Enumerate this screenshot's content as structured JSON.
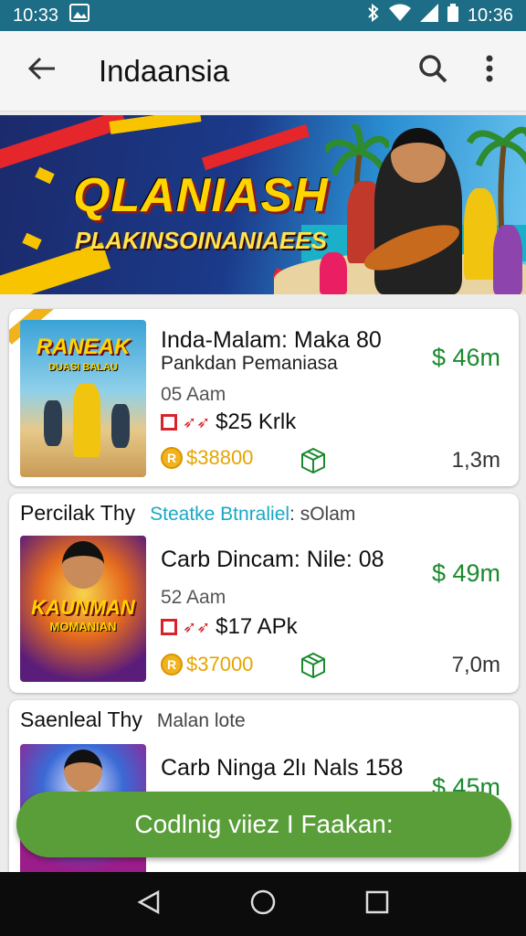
{
  "status_bar": {
    "time_left": "10:33",
    "time_right": "10:36",
    "background": "#1e6d86",
    "icons": [
      "image-icon",
      "bluetooth-icon",
      "wifi-icon",
      "signal-icon",
      "battery-icon"
    ]
  },
  "app_bar": {
    "title": "Indaansia",
    "icons": [
      "back-arrow-icon",
      "search-icon",
      "more-vert-icon"
    ]
  },
  "banner": {
    "title": "QLANIASH",
    "subtitle": "PLAKINSOINANIAEES"
  },
  "cards": [
    {
      "header_title": "",
      "header_sub": "",
      "thumb_title": "RANEAK",
      "thumb_title2": "DUASI BALAU",
      "title": "Inda-Malam: Maka 80",
      "subtitle": "Pankdan Pemaniasa",
      "time": "05 Aam",
      "price": "$25 Krlk",
      "coin_value": "$38800",
      "green_price": "$ 46m",
      "count": "1,3m"
    },
    {
      "header_title": "Percilak Thy",
      "header_sub": "Steatke Btnraliel",
      "header_sub2": ": sOlam",
      "thumb_title": "KAUNMAN",
      "thumb_title2": "MOMANIAN",
      "title": "Carb Dincam: Nile: 08",
      "subtitle": "",
      "time": "52 Aam",
      "price": "$17 APk",
      "coin_value": "$37000",
      "green_price": "$ 49m",
      "count": "7,0m"
    },
    {
      "header_title": "Saenleal Thy",
      "header_sub": "Malan lote",
      "title": "Carb Ninga 2lı Nals 158",
      "green_price": "$ 45m"
    }
  ],
  "fab": {
    "label": "Codlnig viiez I Faakan:",
    "color": "#5a9e3a"
  },
  "colors": {
    "green_text": "#1a8a2e",
    "coin": "#e6a400",
    "teal_link": "#18a8c4",
    "red_mark": "#d8232a"
  },
  "nav_bar": {
    "icons": [
      "back-triangle-icon",
      "home-circle-icon",
      "recents-square-icon"
    ]
  }
}
